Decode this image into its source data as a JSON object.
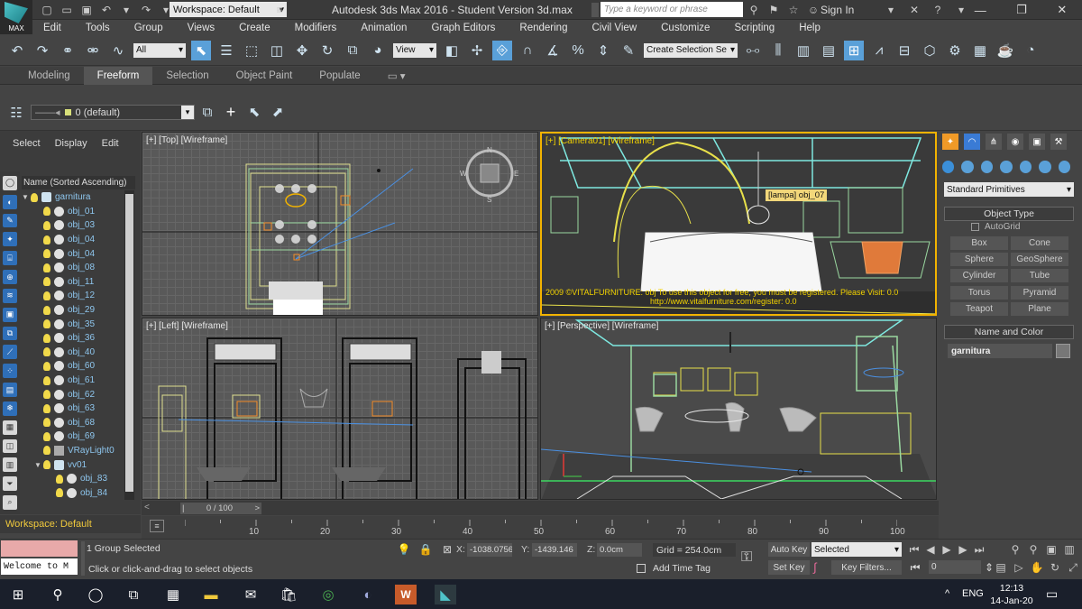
{
  "titlebar": {
    "logo_text": "MAX",
    "workspace": "Workspace: Default",
    "app_title": "Autodesk 3ds Max 2016 - Student Version    3d.max",
    "search_placeholder": "Type a keyword or phrase",
    "sign_in": "Sign In"
  },
  "menu": [
    "Edit",
    "Tools",
    "Group",
    "Views",
    "Create",
    "Modifiers",
    "Animation",
    "Graph Editors",
    "Rendering",
    "Civil View",
    "Customize",
    "Scripting",
    "Help"
  ],
  "main_toolbar": {
    "filter": "All",
    "ref_coord": "View",
    "selection_set": "Create Selection Se"
  },
  "ribbon_tabs": [
    "Modeling",
    "Freeform",
    "Selection",
    "Object Paint",
    "Populate"
  ],
  "ribbon_active": "Freeform",
  "layer": {
    "current": "0 (default)"
  },
  "explorer": {
    "tabs": [
      "Select",
      "Display",
      "Edit"
    ],
    "column_header": "Name (Sorted Ascending)",
    "items": [
      {
        "name": "garnitura",
        "type": "group",
        "level": 0
      },
      {
        "name": "obj_01",
        "type": "object",
        "level": 1
      },
      {
        "name": "obj_03",
        "type": "object",
        "level": 1
      },
      {
        "name": "obj_04",
        "type": "object",
        "level": 1
      },
      {
        "name": "obj_04",
        "type": "object",
        "level": 1
      },
      {
        "name": "obj_08",
        "type": "object",
        "level": 1
      },
      {
        "name": "obj_11",
        "type": "object",
        "level": 1
      },
      {
        "name": "obj_12",
        "type": "object",
        "level": 1
      },
      {
        "name": "obj_29",
        "type": "object",
        "level": 1
      },
      {
        "name": "obj_35",
        "type": "object",
        "level": 1
      },
      {
        "name": "obj_36",
        "type": "object",
        "level": 1
      },
      {
        "name": "obj_40",
        "type": "object",
        "level": 1
      },
      {
        "name": "obj_60",
        "type": "object",
        "level": 1
      },
      {
        "name": "obj_61",
        "type": "object",
        "level": 1
      },
      {
        "name": "obj_62",
        "type": "object",
        "level": 1
      },
      {
        "name": "obj_63",
        "type": "object",
        "level": 1
      },
      {
        "name": "obj_68",
        "type": "object",
        "level": 1
      },
      {
        "name": "obj_69",
        "type": "object",
        "level": 1
      },
      {
        "name": "VRayLight0",
        "type": "light",
        "level": 1
      },
      {
        "name": "vv01",
        "type": "group",
        "level": 1
      },
      {
        "name": "obj_83",
        "type": "object",
        "level": 2
      },
      {
        "name": "obj_84",
        "type": "object",
        "level": 2
      }
    ],
    "workspace_status": "Workspace: Default"
  },
  "viewports": {
    "top": "[+] [Top] [Wireframe]",
    "camera": "[+] [Camera01] [Wireframe]",
    "left": "[+] [Left] [Wireframe]",
    "perspective": "[+] [Perspective] [Wireframe]",
    "camera_tooltip": "[lampa] obj_07",
    "camera_notice": "2009 ©VITALFURNITURE: obj To use this object for free, you must be registered. Please Visit: 0.0",
    "camera_notice2": "http://www.vitalfurniture.com/register: 0.0",
    "compass_n": "N",
    "compass_s": "S",
    "compass_e": "E",
    "compass_w": "W"
  },
  "command_panel": {
    "category": "Standard Primitives",
    "object_type_title": "Object Type",
    "autogrid": "AutoGrid",
    "buttons": [
      "Box",
      "Cone",
      "Sphere",
      "GeoSphere",
      "Cylinder",
      "Tube",
      "Torus",
      "Pyramid",
      "Teapot",
      "Plane"
    ],
    "name_color_title": "Name and Color",
    "object_name": "garnitura"
  },
  "timeline": {
    "slider": "0 / 100",
    "ticks": [
      "10",
      "20",
      "30",
      "40",
      "50",
      "60",
      "70",
      "80",
      "90",
      "100"
    ]
  },
  "status": {
    "listener": "Welcome to M",
    "selection": "1 Group Selected",
    "prompt": "Click or click-and-drag to select objects",
    "x_label": "X:",
    "x": "-1038.0756",
    "y_label": "Y:",
    "y": "-1439.146",
    "z_label": "Z:",
    "z": "0.0cm",
    "grid": "Grid = 254.0cm",
    "add_time_tag": "Add Time Tag",
    "auto_key": "Auto Key",
    "set_key": "Set Key",
    "key_mode": "Selected",
    "key_filters": "Key Filters...",
    "frame": "0"
  },
  "taskbar": {
    "lang": "ENG",
    "time": "12:13",
    "date": "14-Jan-20"
  },
  "colors": {
    "accent": "#5aa0d8",
    "camera_border": "#f2b300",
    "wire_yellow": "#e8e04a",
    "wire_green": "#9ad8a0",
    "wire_cyan": "#7ee8e0",
    "orange_object": "#e07a3a"
  }
}
